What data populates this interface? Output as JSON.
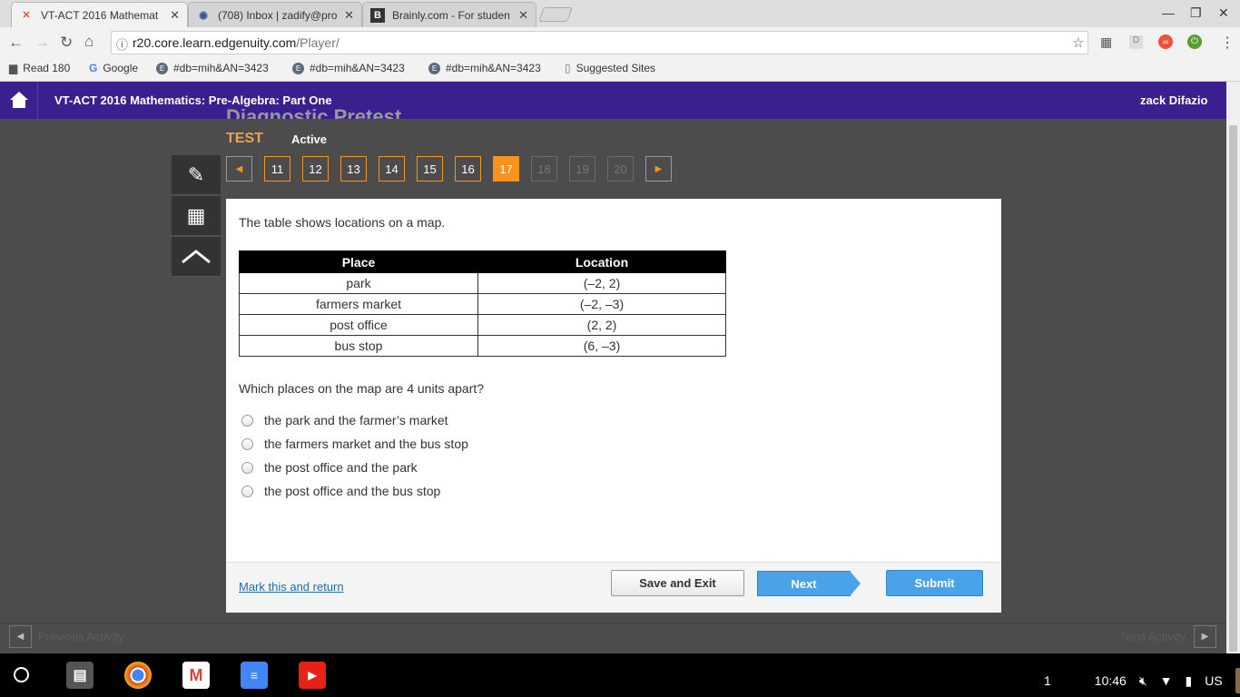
{
  "browser": {
    "tabs": [
      {
        "title": "VT-ACT 2016 Mathemat"
      },
      {
        "title": "(708) Inbox | zadify@pro"
      },
      {
        "title": "Brainly.com - For studen"
      }
    ],
    "url_host": "r20.core.learn.edgenuity.com",
    "url_path": "/Player/",
    "bookmarks": [
      "Read 180",
      "Google",
      "#db=mih&AN=3423",
      "#db=mih&AN=3423",
      "#db=mih&AN=3423",
      "Suggested Sites"
    ]
  },
  "app": {
    "course_title": "VT-ACT 2016 Mathematics: Pre-Algebra: Part One",
    "user_name": "zack Difazio",
    "heading_partial": "Diagnostic Pretest",
    "test_label": "TEST",
    "status": "Active"
  },
  "nav": {
    "questions": [
      "11",
      "12",
      "13",
      "14",
      "15",
      "16",
      "17",
      "18",
      "19",
      "20"
    ],
    "current": "17"
  },
  "question": {
    "prompt": "The table shows locations on a map.",
    "table": {
      "headers": [
        "Place",
        "Location"
      ],
      "rows": [
        [
          "park",
          "(–2, 2)"
        ],
        [
          "farmers market",
          "(–2, –3)"
        ],
        [
          "post office",
          "(2, 2)"
        ],
        [
          "bus stop",
          "(6, –3)"
        ]
      ]
    },
    "ask": "Which places on the map are 4 units apart?",
    "options": [
      "the park and the farmer’s market",
      "the farmers market and the bus stop",
      "the post office and the park",
      "the post office and the bus stop"
    ]
  },
  "footer": {
    "mark_return": "Mark this and return",
    "save_exit": "Save and Exit",
    "next": "Next",
    "submit": "Submit"
  },
  "activity": {
    "prev": "Previous Activity",
    "next": "Next Activity"
  },
  "system": {
    "notifications": "1",
    "time": "10:46",
    "locale": "US"
  }
}
